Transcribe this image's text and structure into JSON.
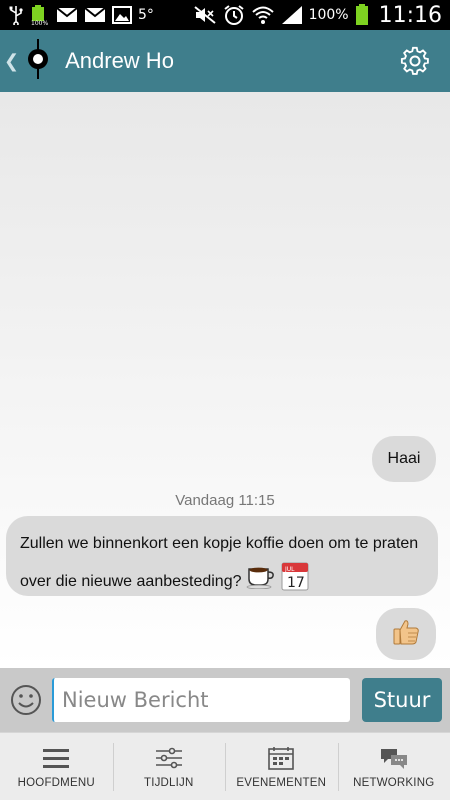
{
  "status_bar": {
    "temperature": "5°",
    "battery_percent": "100%",
    "time": "11:16",
    "icons": [
      "usb-icon",
      "battery-small-icon",
      "mail-icon",
      "mail-icon",
      "image-icon",
      "mute-icon",
      "alarm-icon",
      "wifi-icon",
      "signal-icon",
      "battery-icon"
    ]
  },
  "header": {
    "contact_name": "Andrew Ho",
    "color": "#3f7e8c"
  },
  "chat": {
    "messages": [
      {
        "direction": "outgoing",
        "text": "Haai"
      },
      {
        "direction": "incoming",
        "text": "Zullen we binnenkort een kopje koffie doen om te praten over die nieuwe aanbesteding?",
        "emojis": [
          "coffee-emoji",
          "calendar-emoji"
        ]
      },
      {
        "direction": "outgoing",
        "emojis": [
          "thumbs-up-emoji"
        ]
      }
    ],
    "timestamp": "Vandaag 11:15",
    "calendar_emoji": {
      "month": "JUL",
      "day": "17"
    }
  },
  "composer": {
    "placeholder": "Nieuw Bericht",
    "send_label": "Stuur"
  },
  "bottom_nav": {
    "items": [
      {
        "label": "HOOFDMENU",
        "icon": "menu-icon"
      },
      {
        "label": "TIJDLIJN",
        "icon": "sliders-icon"
      },
      {
        "label": "EVENEMENTEN",
        "icon": "calendar-icon"
      },
      {
        "label": "NETWORKING",
        "icon": "chat-bubbles-icon"
      }
    ]
  }
}
